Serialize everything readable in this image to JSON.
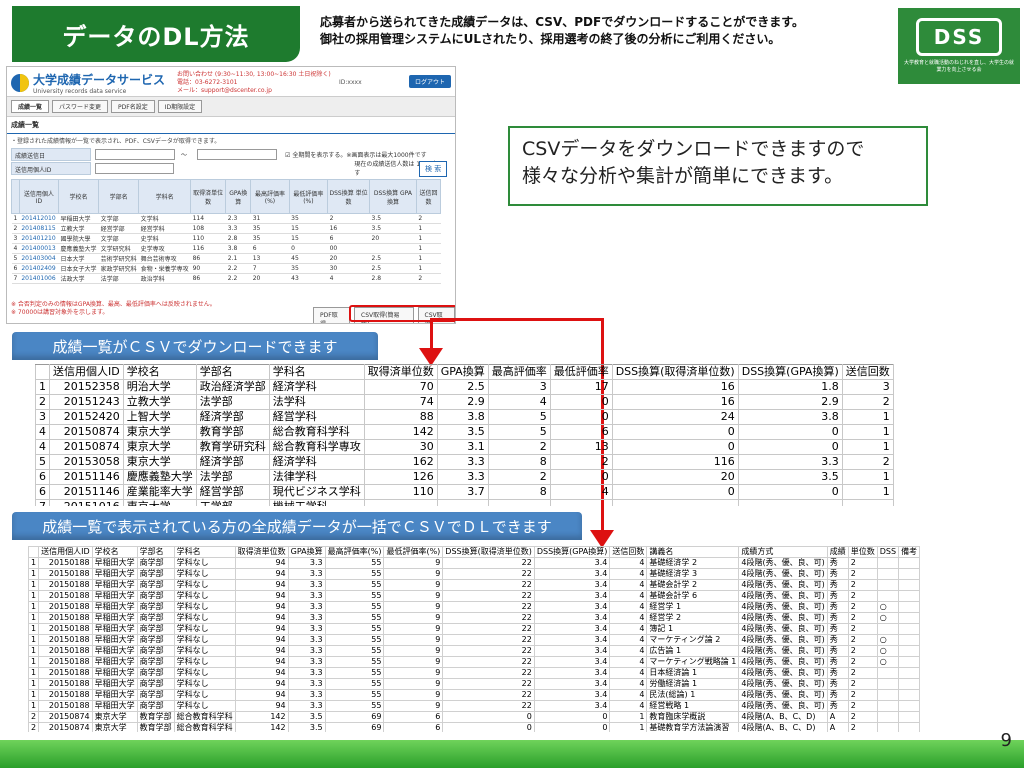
{
  "header": {
    "title": "データのDL方法",
    "intro_line1": "応募者から送られてきた成績データは、CSV、PDFでダウンロードすることができます。",
    "intro_line2": "御社の採用管理システムにULされたり、採用選考の終了後の分析にご利用ください。",
    "logo_text": "DSS",
    "logo_tag": "大学教育と就職活動のねじれを直し、大学生の就業力を向上させる会"
  },
  "app": {
    "brand_jp": "大学成績データサービス",
    "brand_en": "University records data service",
    "contact_hours": "お問い合わせ (9:30~11:30, 13:00~16:30 土日祝除く)",
    "contact_phone": "電話：03-6272-3101",
    "contact_mail": "メール：support@dscenter.co.jp",
    "user_id": "ID:xxxx",
    "logout": "ログアウト",
    "nav": [
      "成績一覧",
      "パスワード変更",
      "PDF名設定",
      "ID期限設定"
    ],
    "section_title": "成績一覧",
    "description": "・登録された成績情報が一覧で表示され、PDF、CSVデータが取得できます。",
    "form_label_date": "成績送信日",
    "form_label_id": "送信用個人ID",
    "tilde": "～",
    "check_text": "全期間を表示する。※画面表示は最大1000件です",
    "total_text": "現在の成績送信人数は 1264人 です",
    "search_button": "検 索",
    "table_headers": [
      "送信用個人ID",
      "学校名",
      "学部名",
      "学科名",
      "取得済単位数",
      "GPA換算",
      "最高評価率(%)",
      "最低評価率(%)",
      "DSS換算 単位数",
      "DSS換算 GPA換算",
      "送信回数"
    ],
    "rows": [
      [
        "1",
        "201412010",
        "早稲田大学",
        "文学部",
        "文学科",
        "114",
        "2.3",
        "31",
        "35",
        "2",
        "3.5",
        "2"
      ],
      [
        "2",
        "201408115",
        "立教大学",
        "経営学部",
        "経営学科",
        "108",
        "3.3",
        "35",
        "15",
        "16",
        "3.5",
        "1"
      ],
      [
        "3",
        "201401210",
        "國學院大學",
        "文学部",
        "史学科",
        "110",
        "2.8",
        "35",
        "15",
        "6",
        "20",
        "1"
      ],
      [
        "4",
        "201400013",
        "慶應義塾大学",
        "文学研究科",
        "史学専攻",
        "116",
        "3.8",
        "6",
        "0",
        "00",
        "",
        "1"
      ],
      [
        "5",
        "201403004",
        "日本大学",
        "芸術学研究科",
        "舞台芸術専攻",
        "86",
        "2.1",
        "13",
        "45",
        "20",
        "2.5",
        "1"
      ],
      [
        "6",
        "201402409",
        "日本女子大学",
        "家政学研究科",
        "食物・栄養学専攻",
        "90",
        "2.2",
        "7",
        "35",
        "30",
        "2.5",
        "1"
      ],
      [
        "7",
        "201401006",
        "法政大学",
        "法学部",
        "政治学科",
        "86",
        "2.2",
        "20",
        "43",
        "4",
        "2.8",
        "2"
      ]
    ],
    "note1": "※ 合否判定のみの情報はGPA換算、最高、最低評価率へは反映されません。",
    "note2": "※ 70000は講習対象外を示します。",
    "buttons": [
      "PDF取得",
      "CSV取得(簡易版)",
      "CSV取得"
    ]
  },
  "callout": {
    "line1": "CSVデータをダウンロードできますので",
    "line2": "様々な分析や集計が簡単にできます。"
  },
  "label1": "成績一覧がＣＳＶでダウンロードできます",
  "label2": "成績一覧で表示されている方の全成績データが一括でＣＳＶでＤＬできます",
  "table1": {
    "headers": [
      "",
      "送信用個人ID",
      "学校名",
      "学部名",
      "学科名",
      "取得済単位数",
      "GPA換算",
      "最高評価率",
      "最低評価率",
      "DSS換算(取得済単位数)",
      "DSS換算(GPA換算)",
      "送信回数"
    ],
    "rows": [
      [
        "1",
        "20152358",
        "明治大学",
        "政治経済学部",
        "経済学科",
        "70",
        "2.5",
        "3",
        "17",
        "16",
        "1.8",
        "3"
      ],
      [
        "2",
        "20151243",
        "立教大学",
        "法学部",
        "法学科",
        "74",
        "2.9",
        "4",
        "0",
        "16",
        "2.9",
        "2"
      ],
      [
        "3",
        "20152420",
        "上智大学",
        "経済学部",
        "経営学科",
        "88",
        "3.8",
        "5",
        "0",
        "24",
        "3.8",
        "1"
      ],
      [
        "4",
        "20150874",
        "東京大学",
        "教育学部",
        "総合教育科学科",
        "142",
        "3.5",
        "5",
        "6",
        "0",
        "0",
        "1"
      ],
      [
        "4",
        "20150874",
        "東京大学",
        "教育学研究科",
        "総合教育科学専攻",
        "30",
        "3.1",
        "2",
        "13",
        "0",
        "0",
        "1"
      ],
      [
        "5",
        "20153058",
        "東京大学",
        "経済学部",
        "経済学科",
        "162",
        "3.3",
        "8",
        "2",
        "116",
        "3.3",
        "2"
      ],
      [
        "6",
        "20151146",
        "慶應義塾大学",
        "法学部",
        "法律学科",
        "126",
        "3.3",
        "2",
        "0",
        "20",
        "3.5",
        "1"
      ],
      [
        "6",
        "20151146",
        "産業能率大学",
        "経営学部",
        "現代ビジネス学科",
        "110",
        "3.7",
        "8",
        "4",
        "0",
        "0",
        "1"
      ],
      [
        "7",
        "20151016",
        "東京大学",
        "工学部",
        "機械工学科",
        "",
        "",
        "",
        "",
        "",
        "",
        ""
      ]
    ]
  },
  "table2": {
    "headers": [
      "",
      "送信用個人ID",
      "学校名",
      "学部名",
      "学科名",
      "取得済単位数",
      "GPA換算",
      "最高評価率(%)",
      "最低評価率(%)",
      "DSS換算(取得済単位数)",
      "DSS換算(GPA換算)",
      "送信回数",
      "講義名",
      "成績方式",
      "成績",
      "単位数",
      "DSS",
      "備考"
    ],
    "rows": [
      [
        "1",
        "20150188",
        "早稲田大学",
        "商学部",
        "学科なし",
        "94",
        "3.3",
        "55",
        "9",
        "22",
        "3.4",
        "4",
        "基礎経済学 2",
        "4段階(秀、優、良、可)",
        "秀",
        "2",
        "",
        ""
      ],
      [
        "1",
        "20150188",
        "早稲田大学",
        "商学部",
        "学科なし",
        "94",
        "3.3",
        "55",
        "9",
        "22",
        "3.4",
        "4",
        "基礎経済学 3",
        "4段階(秀、優、良、可)",
        "秀",
        "2",
        "",
        ""
      ],
      [
        "1",
        "20150188",
        "早稲田大学",
        "商学部",
        "学科なし",
        "94",
        "3.3",
        "55",
        "9",
        "22",
        "3.4",
        "4",
        "基礎会計学 2",
        "4段階(秀、優、良、可)",
        "秀",
        "2",
        "",
        ""
      ],
      [
        "1",
        "20150188",
        "早稲田大学",
        "商学部",
        "学科なし",
        "94",
        "3.3",
        "55",
        "9",
        "22",
        "3.4",
        "4",
        "基礎会計学 6",
        "4段階(秀、優、良、可)",
        "秀",
        "2",
        "",
        ""
      ],
      [
        "1",
        "20150188",
        "早稲田大学",
        "商学部",
        "学科なし",
        "94",
        "3.3",
        "55",
        "9",
        "22",
        "3.4",
        "4",
        "経営学 1",
        "4段階(秀、優、良、可)",
        "秀",
        "2",
        "○",
        ""
      ],
      [
        "1",
        "20150188",
        "早稲田大学",
        "商学部",
        "学科なし",
        "94",
        "3.3",
        "55",
        "9",
        "22",
        "3.4",
        "4",
        "経営学 2",
        "4段階(秀、優、良、可)",
        "秀",
        "2",
        "○",
        ""
      ],
      [
        "1",
        "20150188",
        "早稲田大学",
        "商学部",
        "学科なし",
        "94",
        "3.3",
        "55",
        "9",
        "22",
        "3.4",
        "4",
        "簿記 1",
        "4段階(秀、優、良、可)",
        "秀",
        "2",
        "",
        ""
      ],
      [
        "1",
        "20150188",
        "早稲田大学",
        "商学部",
        "学科なし",
        "94",
        "3.3",
        "55",
        "9",
        "22",
        "3.4",
        "4",
        "マーケティング論 2",
        "4段階(秀、優、良、可)",
        "秀",
        "2",
        "○",
        ""
      ],
      [
        "1",
        "20150188",
        "早稲田大学",
        "商学部",
        "学科なし",
        "94",
        "3.3",
        "55",
        "9",
        "22",
        "3.4",
        "4",
        "広告論 1",
        "4段階(秀、優、良、可)",
        "秀",
        "2",
        "○",
        ""
      ],
      [
        "1",
        "20150188",
        "早稲田大学",
        "商学部",
        "学科なし",
        "94",
        "3.3",
        "55",
        "9",
        "22",
        "3.4",
        "4",
        "マーケティング戦略論 1",
        "4段階(秀、優、良、可)",
        "秀",
        "2",
        "○",
        ""
      ],
      [
        "1",
        "20150188",
        "早稲田大学",
        "商学部",
        "学科なし",
        "94",
        "3.3",
        "55",
        "9",
        "22",
        "3.4",
        "4",
        "日本経済論 1",
        "4段階(秀、優、良、可)",
        "秀",
        "2",
        "",
        ""
      ],
      [
        "1",
        "20150188",
        "早稲田大学",
        "商学部",
        "学科なし",
        "94",
        "3.3",
        "55",
        "9",
        "22",
        "3.4",
        "4",
        "労働経済論 1",
        "4段階(秀、優、良、可)",
        "秀",
        "2",
        "",
        ""
      ],
      [
        "1",
        "20150188",
        "早稲田大学",
        "商学部",
        "学科なし",
        "94",
        "3.3",
        "55",
        "9",
        "22",
        "3.4",
        "4",
        "民法(総論) 1",
        "4段階(秀、優、良、可)",
        "秀",
        "2",
        "",
        ""
      ],
      [
        "1",
        "20150188",
        "早稲田大学",
        "商学部",
        "学科なし",
        "94",
        "3.3",
        "55",
        "9",
        "22",
        "3.4",
        "4",
        "経営戦略 1",
        "4段階(秀、優、良、可)",
        "秀",
        "2",
        "",
        ""
      ],
      [
        "2",
        "20150874",
        "東京大学",
        "教育学部",
        "総合教育科学科",
        "142",
        "3.5",
        "69",
        "6",
        "0",
        "0",
        "1",
        "教育臨床学概説",
        "4段階(A、B、C、D)",
        "A",
        "2",
        "",
        ""
      ],
      [
        "2",
        "20150874",
        "東京大学",
        "教育学部",
        "総合教育科学科",
        "142",
        "3.5",
        "69",
        "6",
        "0",
        "0",
        "1",
        "基礎教育学方法論演習",
        "4段階(A、B、C、D)",
        "A",
        "2",
        "",
        ""
      ]
    ]
  },
  "page_number": "9",
  "colors": {
    "title_green": "#1e7b2e",
    "label_blue": "#4a86c5",
    "arrow_red": "#d11",
    "footer_green": "#2a9f2a"
  }
}
